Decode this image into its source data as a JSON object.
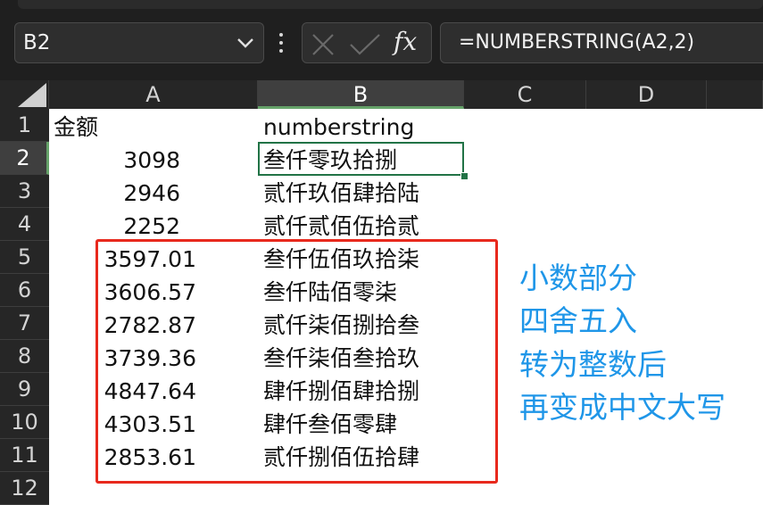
{
  "name_box": {
    "value": "B2"
  },
  "formula_bar": {
    "fx_label": "fx",
    "formula": "=NUMBERSTRING(A2,2)"
  },
  "columns": [
    "A",
    "B",
    "C",
    "D"
  ],
  "rows": [
    {
      "num": "1",
      "a": "金额",
      "b": "numberstring"
    },
    {
      "num": "2",
      "a": "3098",
      "b": "叁仟零玖拾捌"
    },
    {
      "num": "3",
      "a": "2946",
      "b": "贰仟玖佰肆拾陆"
    },
    {
      "num": "4",
      "a": "2252",
      "b": "贰仟贰佰伍拾贰"
    },
    {
      "num": "5",
      "a": "3597.01",
      "b": "叁仟伍佰玖拾柒"
    },
    {
      "num": "6",
      "a": "3606.57",
      "b": "叁仟陆佰零柒"
    },
    {
      "num": "7",
      "a": "2782.87",
      "b": "贰仟柒佰捌拾叁"
    },
    {
      "num": "8",
      "a": "3739.36",
      "b": "叁仟柒佰叁拾玖"
    },
    {
      "num": "9",
      "a": "4847.64",
      "b": "肆仟捌佰肆拾捌"
    },
    {
      "num": "10",
      "a": "4303.51",
      "b": "肆仟叁佰零肆"
    },
    {
      "num": "11",
      "a": "2853.61",
      "b": "贰仟捌佰伍拾肆"
    },
    {
      "num": "12",
      "a": "",
      "b": ""
    }
  ],
  "annotation": [
    "小数部分",
    "四舍五入",
    "转为整数后",
    "再变成中文大写"
  ],
  "colors": {
    "selection": "#217346",
    "highlight_box": "#e8291d",
    "annotation_text": "#1f96e8"
  }
}
